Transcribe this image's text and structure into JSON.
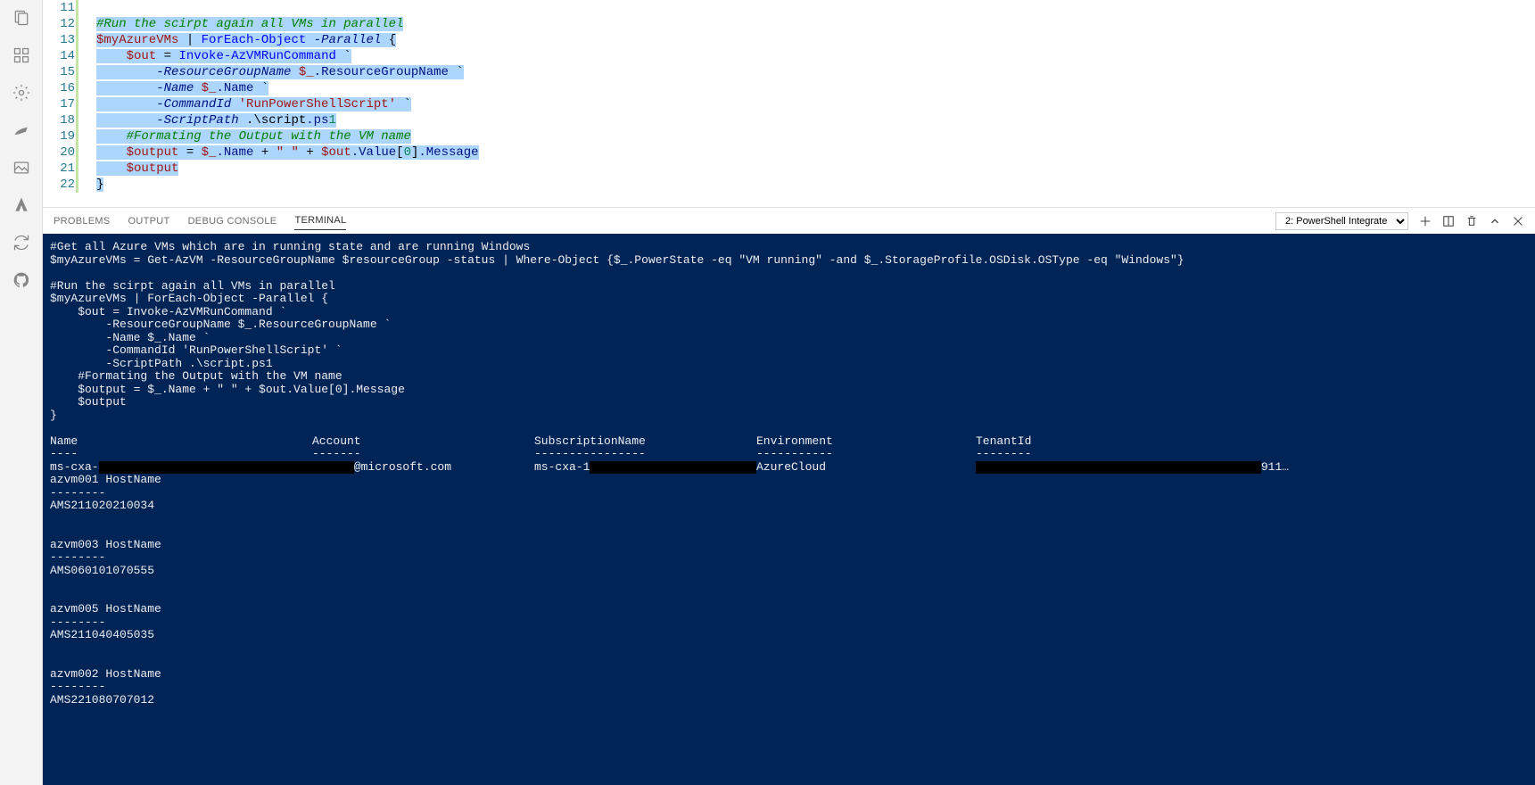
{
  "activity_icons": [
    "files-icon",
    "search-icon",
    "source-control-icon",
    "debug-icon",
    "extensions-icon",
    "azure-icon",
    "settings-icon",
    "git-icon",
    "collapse-icon",
    "sync-icon",
    "toggle-icon"
  ],
  "editor": {
    "line_start": 11,
    "lines": [
      {
        "n": 11,
        "type": "blank",
        "text": ""
      },
      {
        "n": 12,
        "type": "comment",
        "text": "#Run the scirpt again all VMs in parallel"
      },
      {
        "n": 13,
        "text": "$myAzureVMs | ForEach-Object -Parallel {"
      },
      {
        "n": 14,
        "text": "    $out = Invoke-AzVMRunCommand `"
      },
      {
        "n": 15,
        "text": "        -ResourceGroupName $_.ResourceGroupName `"
      },
      {
        "n": 16,
        "text": "        -Name $_.Name `"
      },
      {
        "n": 17,
        "text": "        -CommandId 'RunPowerShellScript' `"
      },
      {
        "n": 18,
        "text": "        -ScriptPath .\\script.ps1"
      },
      {
        "n": 19,
        "type": "comment",
        "text": "    #Formating the Output with the VM name"
      },
      {
        "n": 20,
        "text": "    $output = $_.Name + \" \" + $out.Value[0].Message"
      },
      {
        "n": 21,
        "text": "    $output"
      },
      {
        "n": 22,
        "text": "}"
      }
    ]
  },
  "panel": {
    "tabs": [
      "PROBLEMS",
      "OUTPUT",
      "DEBUG CONSOLE",
      "TERMINAL"
    ],
    "active_tab": "TERMINAL",
    "terminal_selector": "2: PowerShell Integrate"
  },
  "terminal": {
    "lines": [
      "#Get all Azure VMs which are in running state and are running Windows",
      "$myAzureVMs = Get-AzVM -ResourceGroupName $resourceGroup -status | Where-Object {$_.PowerState -eq \"VM running\" -and $_.StorageProfile.OSDisk.OSType -eq \"Windows\"}",
      "",
      "#Run the scirpt again all VMs in parallel",
      "$myAzureVMs | ForEach-Object -Parallel {",
      "    $out = Invoke-AzVMRunCommand `",
      "        -ResourceGroupName $_.ResourceGroupName `",
      "        -Name $_.Name `",
      "        -CommandId 'RunPowerShellScript' `",
      "        -ScriptPath .\\script.ps1",
      "    #Formating the Output with the VM name",
      "    $output = $_.Name + \" \" + $out.Value[0].Message",
      "    $output",
      "}",
      ""
    ],
    "table": {
      "headers": [
        "Name",
        "Account",
        "SubscriptionName",
        "Environment",
        "TenantId"
      ],
      "row": {
        "name_prefix": "ms-cxa-",
        "name_redacted": "                                  ",
        "name_suffix": "…",
        "account_redacted": "      ",
        "account_suffix": "@microsoft.com",
        "sub_prefix": "ms-cxa-1",
        "sub_redacted": "                        ",
        "environment": "AzureCloud",
        "tenant_redacted": "                                         ",
        "tenant_suffix": "911…"
      }
    },
    "results": [
      {
        "host": "azvm001 HostName",
        "value": "AMS211020210034"
      },
      {
        "host": "azvm003 HostName",
        "value": "AMS060101070555"
      },
      {
        "host": "azvm005 HostName",
        "value": "AMS211040405035"
      },
      {
        "host": "azvm002 HostName",
        "value": "AMS221080707012"
      }
    ]
  }
}
